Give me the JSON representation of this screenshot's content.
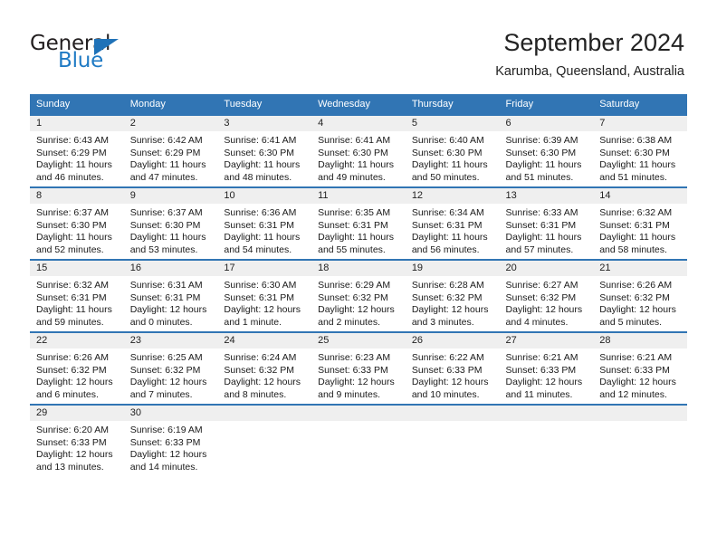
{
  "logo": {
    "word1": "General",
    "word2": "Blue",
    "triangle_color": "#1f72b8",
    "blue_color": "#1f7ac4"
  },
  "header": {
    "title": "September 2024",
    "subtitle": "Karumba, Queensland, Australia"
  },
  "theme": {
    "header_blue": "#3175b4",
    "day_band_gray": "#efefef",
    "page_background": "#ffffff",
    "text_color": "#1a1a1a"
  },
  "columns": [
    "Sunday",
    "Monday",
    "Tuesday",
    "Wednesday",
    "Thursday",
    "Friday",
    "Saturday"
  ],
  "weeks": [
    [
      {
        "day": "1",
        "sunrise": "Sunrise: 6:43 AM",
        "sunset": "Sunset: 6:29 PM",
        "daylight1": "Daylight: 11 hours",
        "daylight2": "and 46 minutes."
      },
      {
        "day": "2",
        "sunrise": "Sunrise: 6:42 AM",
        "sunset": "Sunset: 6:29 PM",
        "daylight1": "Daylight: 11 hours",
        "daylight2": "and 47 minutes."
      },
      {
        "day": "3",
        "sunrise": "Sunrise: 6:41 AM",
        "sunset": "Sunset: 6:30 PM",
        "daylight1": "Daylight: 11 hours",
        "daylight2": "and 48 minutes."
      },
      {
        "day": "4",
        "sunrise": "Sunrise: 6:41 AM",
        "sunset": "Sunset: 6:30 PM",
        "daylight1": "Daylight: 11 hours",
        "daylight2": "and 49 minutes."
      },
      {
        "day": "5",
        "sunrise": "Sunrise: 6:40 AM",
        "sunset": "Sunset: 6:30 PM",
        "daylight1": "Daylight: 11 hours",
        "daylight2": "and 50 minutes."
      },
      {
        "day": "6",
        "sunrise": "Sunrise: 6:39 AM",
        "sunset": "Sunset: 6:30 PM",
        "daylight1": "Daylight: 11 hours",
        "daylight2": "and 51 minutes."
      },
      {
        "day": "7",
        "sunrise": "Sunrise: 6:38 AM",
        "sunset": "Sunset: 6:30 PM",
        "daylight1": "Daylight: 11 hours",
        "daylight2": "and 51 minutes."
      }
    ],
    [
      {
        "day": "8",
        "sunrise": "Sunrise: 6:37 AM",
        "sunset": "Sunset: 6:30 PM",
        "daylight1": "Daylight: 11 hours",
        "daylight2": "and 52 minutes."
      },
      {
        "day": "9",
        "sunrise": "Sunrise: 6:37 AM",
        "sunset": "Sunset: 6:30 PM",
        "daylight1": "Daylight: 11 hours",
        "daylight2": "and 53 minutes."
      },
      {
        "day": "10",
        "sunrise": "Sunrise: 6:36 AM",
        "sunset": "Sunset: 6:31 PM",
        "daylight1": "Daylight: 11 hours",
        "daylight2": "and 54 minutes."
      },
      {
        "day": "11",
        "sunrise": "Sunrise: 6:35 AM",
        "sunset": "Sunset: 6:31 PM",
        "daylight1": "Daylight: 11 hours",
        "daylight2": "and 55 minutes."
      },
      {
        "day": "12",
        "sunrise": "Sunrise: 6:34 AM",
        "sunset": "Sunset: 6:31 PM",
        "daylight1": "Daylight: 11 hours",
        "daylight2": "and 56 minutes."
      },
      {
        "day": "13",
        "sunrise": "Sunrise: 6:33 AM",
        "sunset": "Sunset: 6:31 PM",
        "daylight1": "Daylight: 11 hours",
        "daylight2": "and 57 minutes."
      },
      {
        "day": "14",
        "sunrise": "Sunrise: 6:32 AM",
        "sunset": "Sunset: 6:31 PM",
        "daylight1": "Daylight: 11 hours",
        "daylight2": "and 58 minutes."
      }
    ],
    [
      {
        "day": "15",
        "sunrise": "Sunrise: 6:32 AM",
        "sunset": "Sunset: 6:31 PM",
        "daylight1": "Daylight: 11 hours",
        "daylight2": "and 59 minutes."
      },
      {
        "day": "16",
        "sunrise": "Sunrise: 6:31 AM",
        "sunset": "Sunset: 6:31 PM",
        "daylight1": "Daylight: 12 hours",
        "daylight2": "and 0 minutes."
      },
      {
        "day": "17",
        "sunrise": "Sunrise: 6:30 AM",
        "sunset": "Sunset: 6:31 PM",
        "daylight1": "Daylight: 12 hours",
        "daylight2": "and 1 minute."
      },
      {
        "day": "18",
        "sunrise": "Sunrise: 6:29 AM",
        "sunset": "Sunset: 6:32 PM",
        "daylight1": "Daylight: 12 hours",
        "daylight2": "and 2 minutes."
      },
      {
        "day": "19",
        "sunrise": "Sunrise: 6:28 AM",
        "sunset": "Sunset: 6:32 PM",
        "daylight1": "Daylight: 12 hours",
        "daylight2": "and 3 minutes."
      },
      {
        "day": "20",
        "sunrise": "Sunrise: 6:27 AM",
        "sunset": "Sunset: 6:32 PM",
        "daylight1": "Daylight: 12 hours",
        "daylight2": "and 4 minutes."
      },
      {
        "day": "21",
        "sunrise": "Sunrise: 6:26 AM",
        "sunset": "Sunset: 6:32 PM",
        "daylight1": "Daylight: 12 hours",
        "daylight2": "and 5 minutes."
      }
    ],
    [
      {
        "day": "22",
        "sunrise": "Sunrise: 6:26 AM",
        "sunset": "Sunset: 6:32 PM",
        "daylight1": "Daylight: 12 hours",
        "daylight2": "and 6 minutes."
      },
      {
        "day": "23",
        "sunrise": "Sunrise: 6:25 AM",
        "sunset": "Sunset: 6:32 PM",
        "daylight1": "Daylight: 12 hours",
        "daylight2": "and 7 minutes."
      },
      {
        "day": "24",
        "sunrise": "Sunrise: 6:24 AM",
        "sunset": "Sunset: 6:32 PM",
        "daylight1": "Daylight: 12 hours",
        "daylight2": "and 8 minutes."
      },
      {
        "day": "25",
        "sunrise": "Sunrise: 6:23 AM",
        "sunset": "Sunset: 6:33 PM",
        "daylight1": "Daylight: 12 hours",
        "daylight2": "and 9 minutes."
      },
      {
        "day": "26",
        "sunrise": "Sunrise: 6:22 AM",
        "sunset": "Sunset: 6:33 PM",
        "daylight1": "Daylight: 12 hours",
        "daylight2": "and 10 minutes."
      },
      {
        "day": "27",
        "sunrise": "Sunrise: 6:21 AM",
        "sunset": "Sunset: 6:33 PM",
        "daylight1": "Daylight: 12 hours",
        "daylight2": "and 11 minutes."
      },
      {
        "day": "28",
        "sunrise": "Sunrise: 6:21 AM",
        "sunset": "Sunset: 6:33 PM",
        "daylight1": "Daylight: 12 hours",
        "daylight2": "and 12 minutes."
      }
    ],
    [
      {
        "day": "29",
        "sunrise": "Sunrise: 6:20 AM",
        "sunset": "Sunset: 6:33 PM",
        "daylight1": "Daylight: 12 hours",
        "daylight2": "and 13 minutes."
      },
      {
        "day": "30",
        "sunrise": "Sunrise: 6:19 AM",
        "sunset": "Sunset: 6:33 PM",
        "daylight1": "Daylight: 12 hours",
        "daylight2": "and 14 minutes."
      },
      {
        "day": "",
        "sunrise": "",
        "sunset": "",
        "daylight1": "",
        "daylight2": ""
      },
      {
        "day": "",
        "sunrise": "",
        "sunset": "",
        "daylight1": "",
        "daylight2": ""
      },
      {
        "day": "",
        "sunrise": "",
        "sunset": "",
        "daylight1": "",
        "daylight2": ""
      },
      {
        "day": "",
        "sunrise": "",
        "sunset": "",
        "daylight1": "",
        "daylight2": ""
      },
      {
        "day": "",
        "sunrise": "",
        "sunset": "",
        "daylight1": "",
        "daylight2": ""
      }
    ]
  ]
}
